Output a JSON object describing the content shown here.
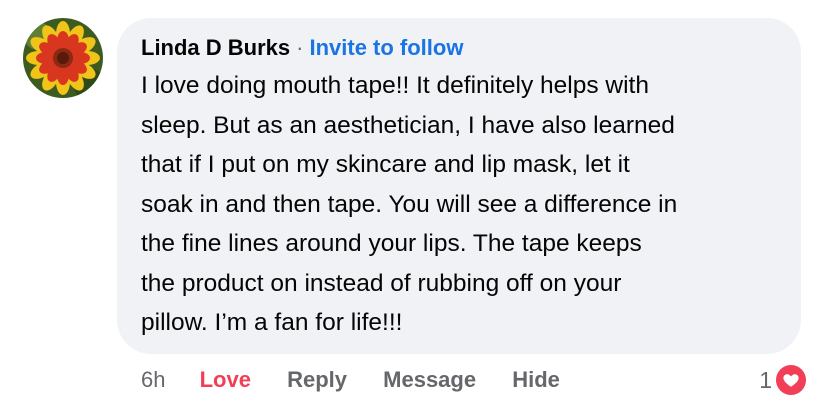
{
  "comment": {
    "author": "Linda D Burks",
    "separator": "·",
    "follow_label": "Invite to follow",
    "text_lines": [
      "I love doing mouth tape!! It definitely helps with",
      "sleep. But as an aesthetician, I have also learned",
      "that if I put on my skincare and lip mask, let it",
      "soak in and then tape. You will see a difference in",
      "the fine lines around your lips. The tape keeps",
      "the product on instead of rubbing off on your",
      "pillow. I’m a fan for life!!!"
    ]
  },
  "actions": {
    "timestamp": "6h",
    "love_label": "Love",
    "reply_label": "Reply",
    "message_label": "Message",
    "hide_label": "Hide"
  },
  "reactions": {
    "count": "1",
    "icon": "heart-icon",
    "color": "#f33e58"
  },
  "colors": {
    "bubble": "#f0f2f5",
    "link": "#1b74e4",
    "muted": "#65676b",
    "love": "#f33e58"
  }
}
